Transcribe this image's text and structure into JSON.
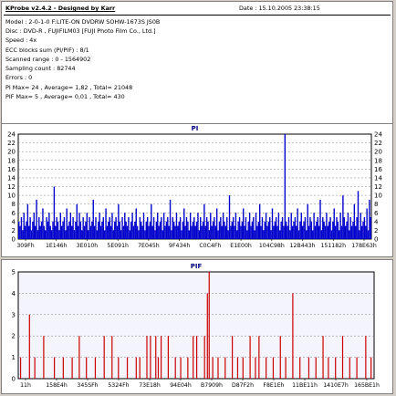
{
  "info": {
    "title": "KProbe v2.4.2 - Designed by Karr",
    "date": "Date : 15.10.2005 23:38:15",
    "lines": [
      "Model : 2-0-1-0 F:LITE-ON DVDRW SOHW-1673S JS0B",
      "Disc : DVD-R , FUJIFILM03 [FUJI Photo Film Co., Ltd.]",
      "Speed : 4x",
      "ECC blocks sum (PI/PIF) : 8/1",
      "Scanned range : 0 - 1564902",
      "Sampling count : 82744",
      "Errors : 0",
      "PI Max= 24 , Average= 1,82 , Total= 21048",
      "PIF Max= 5 , Average= 0,01 , Total= 430"
    ]
  },
  "chart_data": [
    {
      "type": "bar",
      "title": "PI",
      "ylim": [
        0,
        24
      ],
      "yticks": [
        0,
        2,
        4,
        6,
        8,
        10,
        12,
        14,
        16,
        18,
        20,
        22,
        24
      ],
      "xticklabels": [
        "309Fh",
        "1E146h",
        "3E010h",
        "5E091h",
        "7E045h",
        "9F434h",
        "C0C4Fh",
        "E1E00h",
        "104C98h",
        "12B443h",
        "151182h",
        "178E63h"
      ],
      "grid": true,
      "color": "#0000cc",
      "values": [
        4,
        3,
        5,
        2,
        6,
        3,
        4,
        8,
        3,
        5,
        2,
        4,
        6,
        3,
        9,
        2,
        5,
        3,
        4,
        7,
        3,
        2,
        5,
        4,
        6,
        3,
        2,
        4,
        12,
        3,
        5,
        4,
        2,
        6,
        3,
        4,
        5,
        2,
        7,
        3,
        4,
        6,
        3,
        5,
        2,
        4,
        8,
        3,
        6,
        4,
        2,
        5,
        3,
        4,
        6,
        2,
        5,
        3,
        4,
        9,
        3,
        5,
        2,
        4,
        6,
        3,
        4,
        5,
        2,
        7,
        3,
        4,
        5,
        3,
        6,
        2,
        4,
        5,
        3,
        8,
        4,
        2,
        5,
        3,
        6,
        4,
        3,
        5,
        2,
        4,
        6,
        3,
        4,
        7,
        3,
        2,
        5,
        4,
        3,
        6,
        2,
        4,
        5,
        3,
        4,
        8,
        3,
        5,
        2,
        4,
        6,
        3,
        4,
        5,
        2,
        6,
        3,
        4,
        5,
        3,
        9,
        2,
        5,
        4,
        3,
        6,
        3,
        4,
        5,
        2,
        4,
        7,
        3,
        5,
        4,
        2,
        6,
        3,
        4,
        5,
        3,
        4,
        6,
        2,
        5,
        3,
        4,
        8,
        3,
        5,
        4,
        2,
        6,
        3,
        4,
        5,
        3,
        7,
        2,
        4,
        5,
        3,
        6,
        4,
        3,
        5,
        2,
        10,
        3,
        4,
        5,
        3,
        6,
        2,
        4,
        5,
        3,
        4,
        7,
        3,
        5,
        2,
        4,
        6,
        3,
        4,
        5,
        2,
        6,
        3,
        4,
        8,
        3,
        5,
        2,
        4,
        6,
        3,
        4,
        5,
        2,
        7,
        3,
        4,
        5,
        3,
        6,
        2,
        4,
        5,
        3,
        24,
        4,
        3,
        5,
        2,
        6,
        3,
        4,
        5,
        3,
        7,
        2,
        4,
        6,
        3,
        4,
        5,
        2,
        8,
        3,
        5,
        4,
        2,
        6,
        3,
        4,
        5,
        3,
        9,
        2,
        5,
        4,
        3,
        6,
        3,
        4,
        5,
        2,
        4,
        7,
        3,
        5,
        4,
        2,
        6,
        3,
        10,
        5,
        3,
        4,
        6,
        2,
        5,
        3,
        4,
        8,
        3,
        5,
        11,
        2,
        6,
        3,
        4,
        5,
        3,
        7,
        2,
        9,
        5
      ]
    },
    {
      "type": "bar",
      "title": "PIF",
      "ylim": [
        0,
        5
      ],
      "yticks": [
        0,
        1,
        2,
        3,
        4,
        5
      ],
      "xticklabels": [
        "11h",
        "158E4h",
        "345SFh",
        "5324Fh",
        "73E18h",
        "94E04h",
        "B7909h",
        "D87F2h",
        "F8E1Eh",
        "11BE11h",
        "1410E7h",
        "165BE1h"
      ],
      "grid": true,
      "color": "#cc0000",
      "bars": [
        {
          "x": 0.005,
          "v": 1
        },
        {
          "x": 0.03,
          "v": 3
        },
        {
          "x": 0.045,
          "v": 1
        },
        {
          "x": 0.07,
          "v": 2
        },
        {
          "x": 0.1,
          "v": 1
        },
        {
          "x": 0.125,
          "v": 1
        },
        {
          "x": 0.15,
          "v": 1
        },
        {
          "x": 0.17,
          "v": 2
        },
        {
          "x": 0.19,
          "v": 1
        },
        {
          "x": 0.215,
          "v": 1
        },
        {
          "x": 0.24,
          "v": 2
        },
        {
          "x": 0.262,
          "v": 2
        },
        {
          "x": 0.28,
          "v": 1
        },
        {
          "x": 0.305,
          "v": 1
        },
        {
          "x": 0.33,
          "v": 1
        },
        {
          "x": 0.34,
          "v": 1
        },
        {
          "x": 0.36,
          "v": 2
        },
        {
          "x": 0.37,
          "v": 2
        },
        {
          "x": 0.385,
          "v": 2
        },
        {
          "x": 0.392,
          "v": 1
        },
        {
          "x": 0.4,
          "v": 2
        },
        {
          "x": 0.42,
          "v": 2
        },
        {
          "x": 0.44,
          "v": 1
        },
        {
          "x": 0.455,
          "v": 1
        },
        {
          "x": 0.475,
          "v": 1
        },
        {
          "x": 0.49,
          "v": 2
        },
        {
          "x": 0.5,
          "v": 2
        },
        {
          "x": 0.522,
          "v": 2
        },
        {
          "x": 0.53,
          "v": 4
        },
        {
          "x": 0.535,
          "v": 5
        },
        {
          "x": 0.545,
          "v": 1
        },
        {
          "x": 0.56,
          "v": 1
        },
        {
          "x": 0.58,
          "v": 1
        },
        {
          "x": 0.6,
          "v": 2
        },
        {
          "x": 0.615,
          "v": 1
        },
        {
          "x": 0.63,
          "v": 1
        },
        {
          "x": 0.65,
          "v": 2
        },
        {
          "x": 0.665,
          "v": 1
        },
        {
          "x": 0.675,
          "v": 2
        },
        {
          "x": 0.695,
          "v": 1
        },
        {
          "x": 0.715,
          "v": 1
        },
        {
          "x": 0.735,
          "v": 2
        },
        {
          "x": 0.75,
          "v": 1
        },
        {
          "x": 0.77,
          "v": 4
        },
        {
          "x": 0.79,
          "v": 1
        },
        {
          "x": 0.815,
          "v": 1
        },
        {
          "x": 0.835,
          "v": 1
        },
        {
          "x": 0.855,
          "v": 2
        },
        {
          "x": 0.87,
          "v": 1
        },
        {
          "x": 0.89,
          "v": 1
        },
        {
          "x": 0.91,
          "v": 2
        },
        {
          "x": 0.93,
          "v": 1
        },
        {
          "x": 0.95,
          "v": 1
        },
        {
          "x": 0.975,
          "v": 2
        },
        {
          "x": 0.99,
          "v": 1
        }
      ]
    }
  ]
}
